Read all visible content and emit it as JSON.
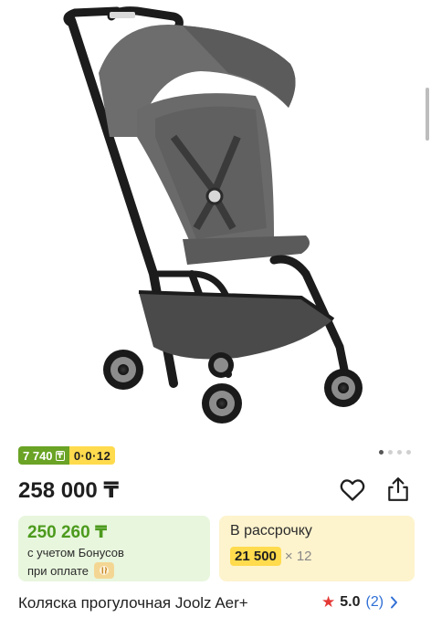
{
  "product": {
    "image_alt": "Коляска Joolz Aer+",
    "gallery_dots": 4,
    "gallery_active_index": 0
  },
  "badges": {
    "price_badge": "7 740",
    "currency_mark": "₸",
    "installment_badge": "0·0·12"
  },
  "price": {
    "main": "258 000 ₸"
  },
  "actions": {
    "favorite_icon": "heart-icon",
    "share_icon": "share-icon"
  },
  "bonus_card": {
    "price": "250 260 ₸",
    "line1": "с учетом Бонусов",
    "line2": "при оплате",
    "payment_icon": "bonus-payment-icon"
  },
  "installment_card": {
    "title": "В рассрочку",
    "amount": "21 500",
    "term": "× 12"
  },
  "title": "Коляска прогулочная Joolz Aer+",
  "rating": {
    "value": "5.0",
    "count": "(2)"
  },
  "colors": {
    "price_badge": "#6aa325",
    "installment_badge": "#ffdb4d",
    "bonus_card_bg": "#e8f6dd",
    "installment_card_bg": "#fdf3cd",
    "bonus_price": "#4c9a1d",
    "star": "#e53935",
    "link": "#2f6fd6"
  }
}
